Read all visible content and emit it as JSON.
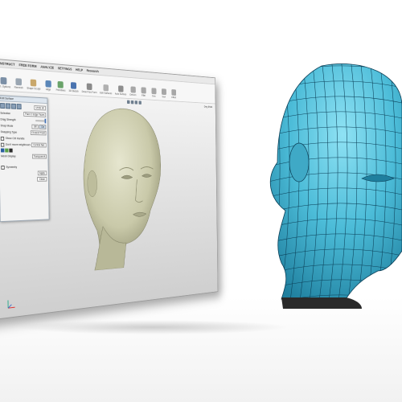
{
  "menu": [
    "CONSTRUCT",
    "FREE FORM",
    "ANALYZE",
    "SETTINGS",
    "HELP",
    "Research"
  ],
  "ribbon": [
    {
      "label": "Ctrl. Options",
      "icon": "layers-icon",
      "color": "#7b8fa6"
    },
    {
      "label": "Remesh",
      "icon": "remesh-icon",
      "color": "#9aa6b2"
    },
    {
      "label": "Shape Sculpt",
      "icon": "sculpt-icon",
      "color": "#c9a76a"
    },
    {
      "label": "Align",
      "icon": "align-icon",
      "color": "#5a86b8"
    },
    {
      "label": "Primitives",
      "icon": "primitives-icon",
      "color": "#6aa36a"
    },
    {
      "label": "3D Sketch",
      "icon": "sketch-icon",
      "color": "#4a74b0"
    },
    {
      "label": "Draw Free Form",
      "icon": "free-form-icon",
      "color": "#8a8a8a"
    },
    {
      "label": "Edit Surfaces",
      "icon": "edit-surface-icon",
      "color": "#b0b0b0"
    },
    {
      "label": "Auto Surface",
      "icon": "auto-surface-icon",
      "color": "#8e8e8e"
    },
    {
      "label": "Deform",
      "icon": "deform-icon",
      "color": "#a7a7a7"
    },
    {
      "label": "Fillet",
      "icon": "fillet-icon",
      "color": "#a7a7a7"
    },
    {
      "label": "Trim",
      "icon": "trim-icon",
      "color": "#a7a7a7"
    },
    {
      "label": "Sew",
      "icon": "sew-icon",
      "color": "#a7a7a7"
    },
    {
      "label": "Offset",
      "icon": "offset-icon",
      "color": "#a7a7a7"
    }
  ],
  "viewport": {
    "mode_label": "Drag Mode"
  },
  "dialog": {
    "title": "Edit Surface",
    "undo_label": "Undo all",
    "selection_label": "Selection",
    "selection_value": "Paint 2 Edge Faces",
    "drag_strength_label": "Drag Strength",
    "snap_mode_label": "Snap Mode",
    "snap_off": "Off",
    "snap_on": "On",
    "snapping_type_label": "Snapping Type",
    "snapping_type_value": "Closest Point",
    "show_ctrl_label": "Show Ctrl Handle",
    "smooth_label": "Don't move neighbours",
    "control_net_label": "Control Net",
    "mesh_display_label": "Mesh Display",
    "mesh_display_value": "Transparent",
    "symmetry_label": "Symmetry",
    "apply_label": "Apply",
    "close_label": "Close"
  },
  "colors": {
    "head_skin": "#cfcfb0",
    "head_shadow": "#8f8f72",
    "mesh_cyan": "#54c0da",
    "mesh_lines": "#0b3f57"
  }
}
